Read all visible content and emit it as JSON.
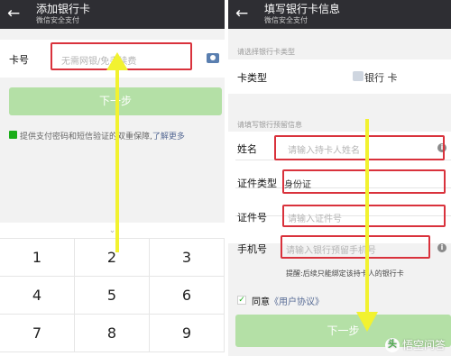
{
  "left": {
    "header": {
      "back_icon": "arrow-left-icon",
      "title": "添加银行卡",
      "subtitle": "微信安全支付"
    },
    "card_row": {
      "label": "卡号",
      "placeholder": "无需网银/免手续费",
      "camera_icon": "camera-icon"
    },
    "next_button": "下一步",
    "security_note": {
      "text": "提供支付密码和短信验证的双重保障,",
      "link": "了解更多"
    },
    "keypad": {
      "collapse_icon": "chevron-down-icon",
      "keys": [
        "1",
        "2",
        "3",
        "4",
        "5",
        "6",
        "7",
        "8",
        "9"
      ]
    }
  },
  "right": {
    "header": {
      "back_icon": "arrow-left-icon",
      "title": "填写银行卡信息",
      "subtitle": "微信安全支付"
    },
    "section_card_type": "请选择银行卡类型",
    "card_type": {
      "label": "卡类型",
      "value": "银行 卡"
    },
    "section_personal": "请填写银行预留信息",
    "name": {
      "label": "姓名",
      "placeholder": "请输入持卡人姓名"
    },
    "id_type": {
      "label": "证件类型",
      "value": "身份证"
    },
    "id_number": {
      "label": "证件号",
      "placeholder": "请输入证件号"
    },
    "phone": {
      "label": "手机号",
      "placeholder": "请输入银行预留手机号"
    },
    "reminder": "提醒:后续只能绑定该持卡人的银行卡",
    "agreement": {
      "prefix": "同意",
      "link": "《用户协议》"
    },
    "next_button": "下一步"
  },
  "watermark": {
    "logo": "头",
    "text": "悟空问答"
  },
  "colors": {
    "header_bg": "#2e2e33",
    "button_green": "#b4e0a6",
    "highlight_red": "#d9323c",
    "arrow_yellow": "#f2f230"
  }
}
